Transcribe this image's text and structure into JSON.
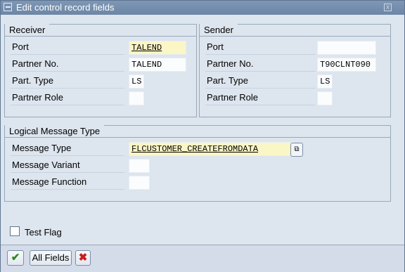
{
  "window": {
    "title": "Edit control record fields",
    "close_glyph": "x"
  },
  "receiver": {
    "title": "Receiver",
    "rows": [
      {
        "label": "Port",
        "value": "TALEND"
      },
      {
        "label": "Partner No.",
        "value": "TALEND"
      },
      {
        "label": "Part. Type",
        "value": "LS"
      },
      {
        "label": "Partner Role",
        "value": ""
      }
    ]
  },
  "sender": {
    "title": "Sender",
    "rows": [
      {
        "label": "Port",
        "value": ""
      },
      {
        "label": "Partner No.",
        "value": "T90CLNT090"
      },
      {
        "label": "Part. Type",
        "value": "LS"
      },
      {
        "label": "Partner Role",
        "value": ""
      }
    ]
  },
  "logical": {
    "title": "Logical Message Type",
    "rows": [
      {
        "label": "Message Type",
        "value": "FLCUSTOMER_CREATEFROMDATA"
      },
      {
        "label": "Message Variant",
        "value": ""
      },
      {
        "label": "Message Function",
        "value": ""
      }
    ]
  },
  "test_flag": {
    "label": "Test Flag",
    "checked": false
  },
  "toolbar": {
    "confirm_icon": "checkmark-icon",
    "all_fields_label": "All Fields",
    "cancel_icon": "cancel-x-icon"
  }
}
